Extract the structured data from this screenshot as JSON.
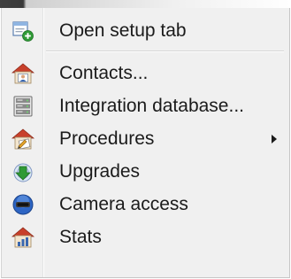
{
  "menu": {
    "items": [
      {
        "label": "Open setup tab",
        "icon": "open-setup-tab-icon"
      },
      {
        "label": "Contacts...",
        "icon": "contacts-icon"
      },
      {
        "label": "Integration database...",
        "icon": "integration-database-icon"
      },
      {
        "label": "Procedures",
        "icon": "procedures-icon",
        "submenu": true
      },
      {
        "label": "Upgrades",
        "icon": "upgrades-icon"
      },
      {
        "label": "Camera access",
        "icon": "camera-access-icon"
      },
      {
        "label": "Stats",
        "icon": "stats-icon"
      }
    ]
  },
  "colors": {
    "menu_background": "#f0f0f0",
    "text": "#1b1b1b",
    "separator": "#d7d7d7"
  }
}
